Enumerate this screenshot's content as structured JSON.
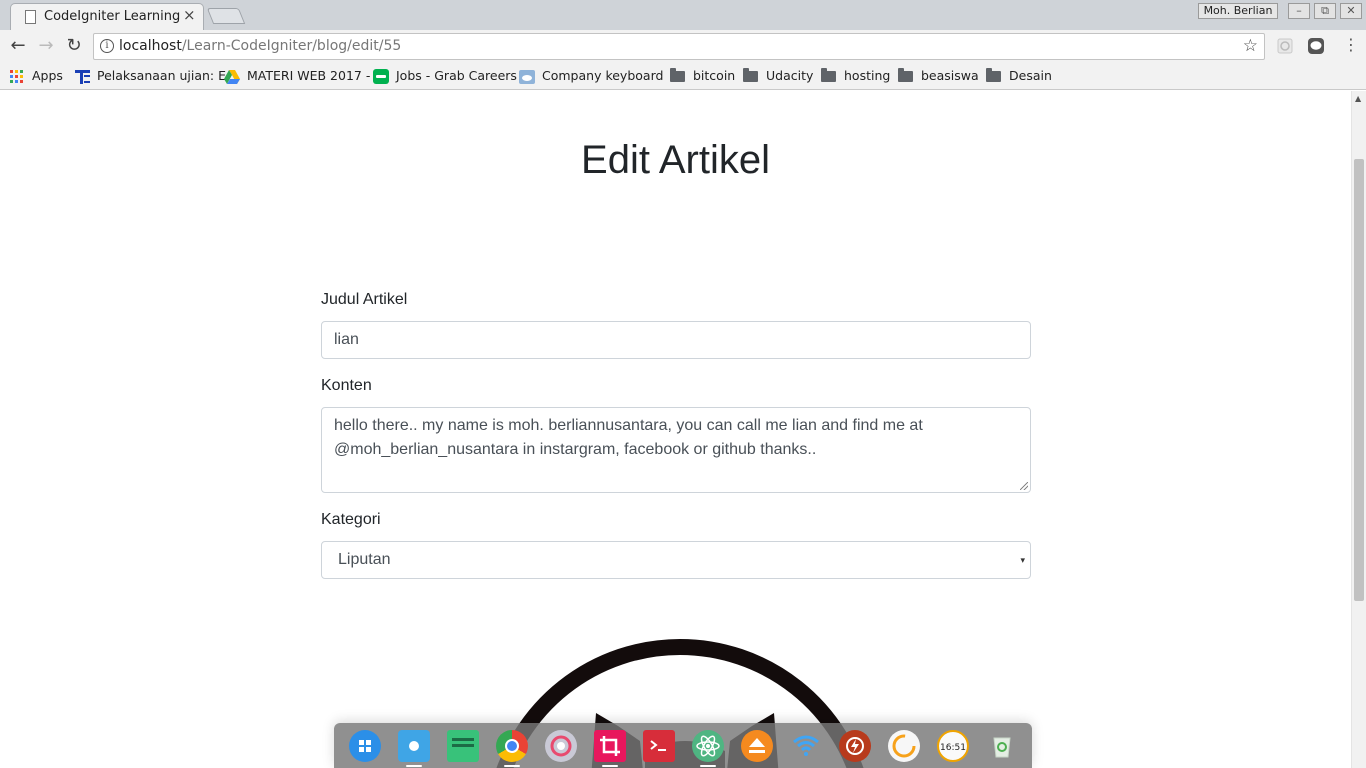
{
  "browser": {
    "tab_title": "CodeIgniter Learning",
    "tab_close": "×",
    "user_name": "Moh. Berlian",
    "window_buttons": [
      "–",
      "⧉",
      "✕"
    ],
    "nav": {
      "back": "←",
      "forward": "→",
      "reload": "↻"
    },
    "url_host": "localhost",
    "url_path": "/Learn-CodeIgniter/blog/edit/55",
    "info_glyph": "i",
    "star_glyph": "☆",
    "menu_glyph": "⋮"
  },
  "bookmarks": [
    {
      "label": "Apps",
      "icon": "apps-grid-icon"
    },
    {
      "label": "Pelaksanaan ujian: E",
      "icon": "te-icon"
    },
    {
      "label": "MATERI WEB 2017 -",
      "icon": "google-drive-icon"
    },
    {
      "label": "Jobs - Grab Careers",
      "icon": "grab-icon"
    },
    {
      "label": "Company keyboard",
      "icon": "cloud-icon"
    },
    {
      "label": "bitcoin",
      "icon": "folder-icon"
    },
    {
      "label": "Udacity",
      "icon": "folder-icon"
    },
    {
      "label": "hosting",
      "icon": "folder-icon"
    },
    {
      "label": "beasiswa",
      "icon": "folder-icon"
    },
    {
      "label": "Desain",
      "icon": "folder-icon"
    }
  ],
  "page": {
    "title": "Edit Artikel",
    "form": {
      "judul_label": "Judul Artikel",
      "judul_value": "lian",
      "konten_label": "Konten",
      "konten_value": "hello there.. my name is moh. berliannusantara, you can call me lian and find me at @moh_berlian_nusantara in instargram, facebook or github thanks..",
      "kategori_label": "Kategori",
      "kategori_value": "Liputan",
      "kategori_caret": "▾"
    }
  },
  "dock": {
    "apps": [
      "launcher-icon",
      "file-manager-icon",
      "terminal-green-icon",
      "chrome-icon",
      "settings-icon",
      "screenshot-icon",
      "terminal-icon",
      "atom-icon",
      "eject-icon",
      "wifi-icon",
      "power-icon",
      "app-orange-icon",
      "clock-icon",
      "trash-icon"
    ],
    "clock_text": "16:51"
  },
  "colors": {
    "chrome_bg": "#f2f2f2",
    "title_text": "#212529",
    "input_border": "#ced4da",
    "input_text": "#495057"
  }
}
